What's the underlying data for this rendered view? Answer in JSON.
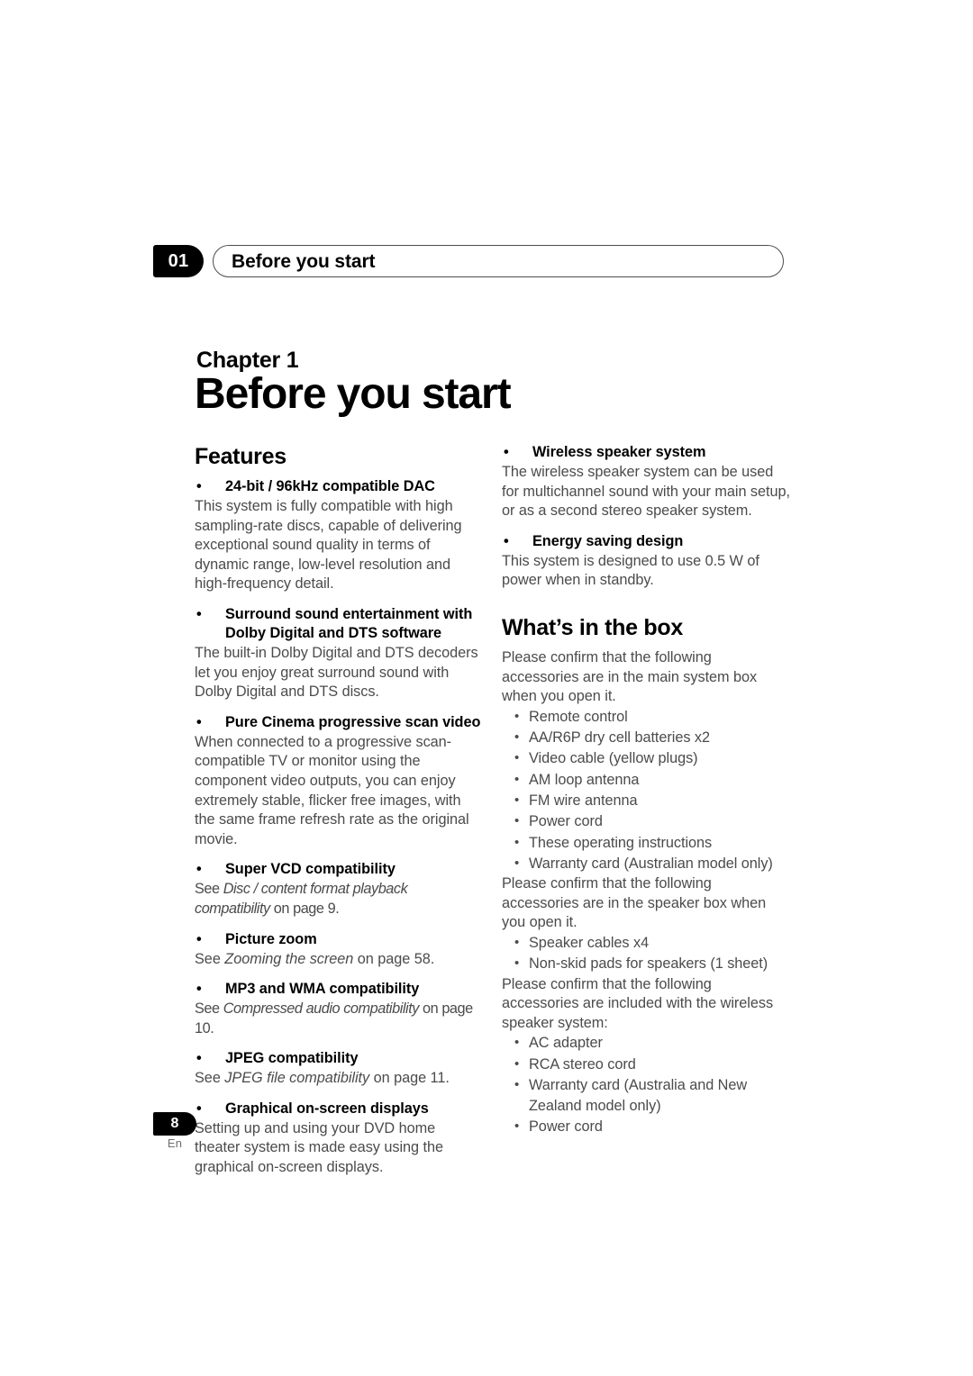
{
  "header": {
    "chapter_number": "01",
    "running_title": "Before you start"
  },
  "title_block": {
    "chapter_label": "Chapter 1",
    "title": "Before you start"
  },
  "left_column": {
    "section_heading": "Features",
    "bullet_glyph": "•",
    "features": [
      {
        "heading": "24-bit / 96kHz compatible DAC",
        "body": "This system is fully compatible with high sampling-rate discs, capable of delivering exceptional sound quality in terms of dynamic range, low-level resolution and high-frequency detail."
      },
      {
        "heading": "Surround sound entertainment with Dolby Digital and DTS software",
        "body": "The built-in Dolby Digital and DTS decoders let you enjoy great surround sound with Dolby Digital and DTS discs."
      },
      {
        "heading": "Pure Cinema progressive scan video",
        "body": "When connected to a progressive scan-compatible TV or monitor using the component video outputs, you can enjoy extremely stable, flicker free images, with the same frame refresh rate as the original movie."
      },
      {
        "heading": "Super VCD compatibility",
        "body_prefix": "See ",
        "body_italic": "Disc / content format playback compatibility",
        "body_suffix": " on page 9."
      },
      {
        "heading": "Picture zoom",
        "body_prefix": "See ",
        "body_italic": "Zooming the screen",
        "body_suffix": " on page 58."
      },
      {
        "heading": "MP3 and WMA compatibility",
        "body_prefix": "See ",
        "body_italic": "Compressed audio compatibility",
        "body_suffix": " on page 10."
      },
      {
        "heading": "JPEG compatibility",
        "body_prefix": "See ",
        "body_italic": "JPEG file compatibility",
        "body_suffix": " on page 11."
      },
      {
        "heading": "Graphical on-screen displays",
        "body": "Setting up and using your DVD home theater system is made easy using the graphical on-screen displays."
      }
    ]
  },
  "right_column": {
    "bullet_glyph": "•",
    "features": [
      {
        "heading": "Wireless speaker system",
        "body": "The wireless speaker system can be used for multichannel sound with your main setup, or as a second stereo speaker system."
      },
      {
        "heading": "Energy saving design",
        "body": "This system is designed to use 0.5 W of power when in standby."
      }
    ],
    "section_heading": "What’s in the box",
    "groups": [
      {
        "intro": "Please confirm that the following accessories are in the main system box when you open it.",
        "items": [
          "Remote control",
          "AA/R6P dry cell batteries x2",
          "Video cable (yellow plugs)",
          "AM loop antenna",
          "FM wire antenna",
          "Power cord",
          "These operating instructions",
          "Warranty card (Australian model only)"
        ]
      },
      {
        "intro": "Please confirm that the following accessories are in the speaker box when you open it.",
        "items": [
          "Speaker cables x4",
          "Non-skid pads for speakers (1 sheet)"
        ]
      },
      {
        "intro": "Please confirm that the following accessories are included with the wireless speaker system:",
        "items": [
          "AC adapter",
          "RCA stereo cord",
          "Warranty card (Australia and New Zealand model only)",
          "Power cord"
        ]
      }
    ]
  },
  "footer": {
    "page_number": "8",
    "language": "En"
  }
}
